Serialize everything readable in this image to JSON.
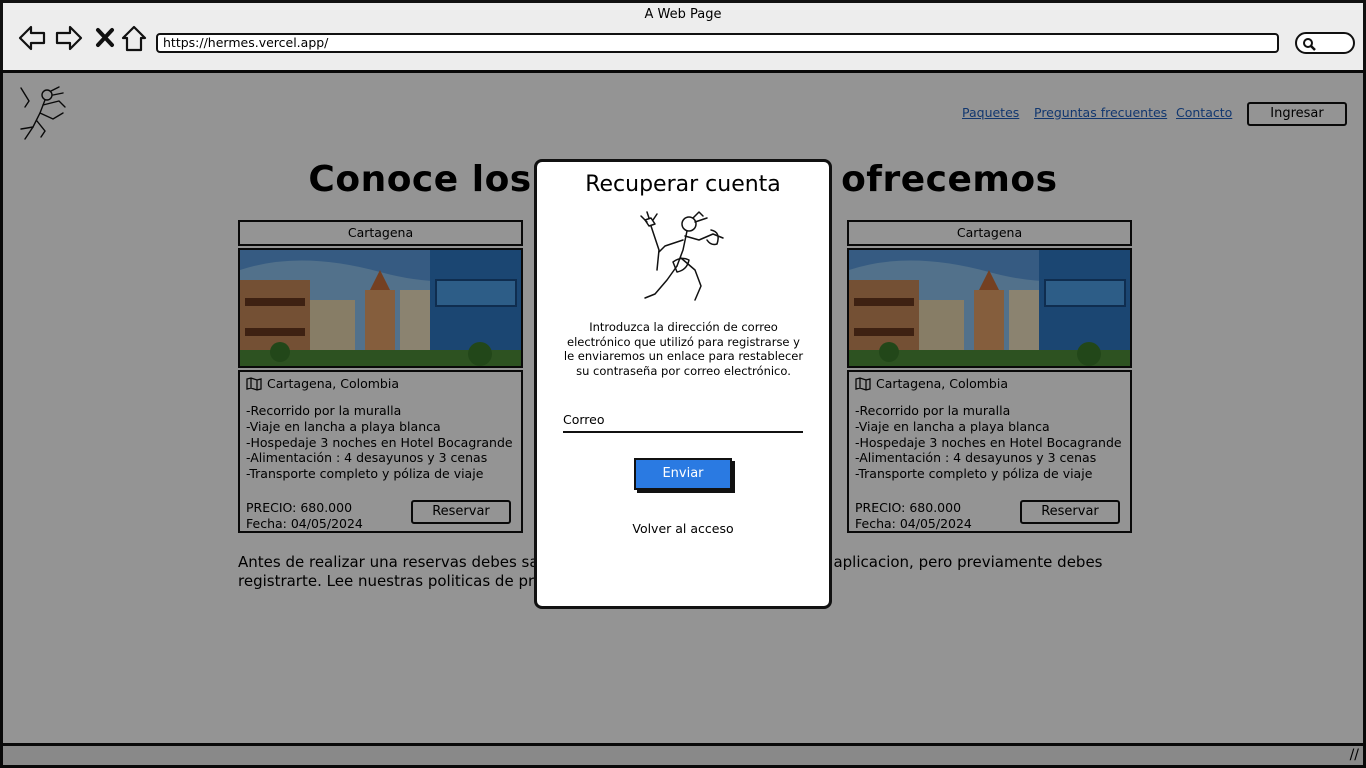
{
  "browser": {
    "window_title": "A Web Page",
    "url": "https://hermes.vercel.app/"
  },
  "header": {
    "nav": [
      "Paquetes",
      "Preguntas frecuentes",
      "Contacto"
    ],
    "login_label": "Ingresar"
  },
  "main": {
    "heading": "Conoce los paquetes que ofrecemos",
    "cards": [
      {
        "title": "Cartagena",
        "location": "Cartagena, Colombia",
        "features": [
          "-Recorrido por la muralla",
          "-Viaje en lancha a playa blanca",
          "-Hospedaje 3 noches en Hotel Bocagrande",
          "-Alimentación : 4 desayunos y 3 cenas",
          "-Transporte completo y póliza de viaje"
        ],
        "price": "PRECIO: 680.000",
        "date": "Fecha: 04/05/2024",
        "button": "Reservar"
      },
      {
        "title": "Cartagena",
        "location": "Cartagena, Colombia",
        "features": [
          "-Recorrido por la muralla",
          "-Viaje en lancha a playa blanca",
          "-Hospedaje 3 noches en Hotel Bocagrande",
          "-Alimentación : 4 desayunos y 3 cenas",
          "-Transporte completo y póliza de viaje"
        ],
        "price": "PRECIO: 680.000",
        "date": "Fecha: 04/05/2024",
        "button": "Reservar"
      }
    ],
    "notice": "Antes de realizar una reservas debes saber que puedes hacerlo desde nuestra aplicacion, pero previamente debes registrarte. Lee nuestras politicas de privacidad."
  },
  "modal": {
    "title": "Recuperar cuenta",
    "description": "Introduzca la dirección de correo electrónico que utilizó para registrarse y le enviaremos un enlace para restablecer su contraseña por correo electrónico.",
    "email_label": "Correo",
    "submit_label": "Enviar",
    "back_label": "Volver al acceso"
  },
  "colors": {
    "link": "#1f5fbf",
    "primary_button": "#2a7ae2",
    "overlay": "rgba(0,0,0,0.42)"
  }
}
